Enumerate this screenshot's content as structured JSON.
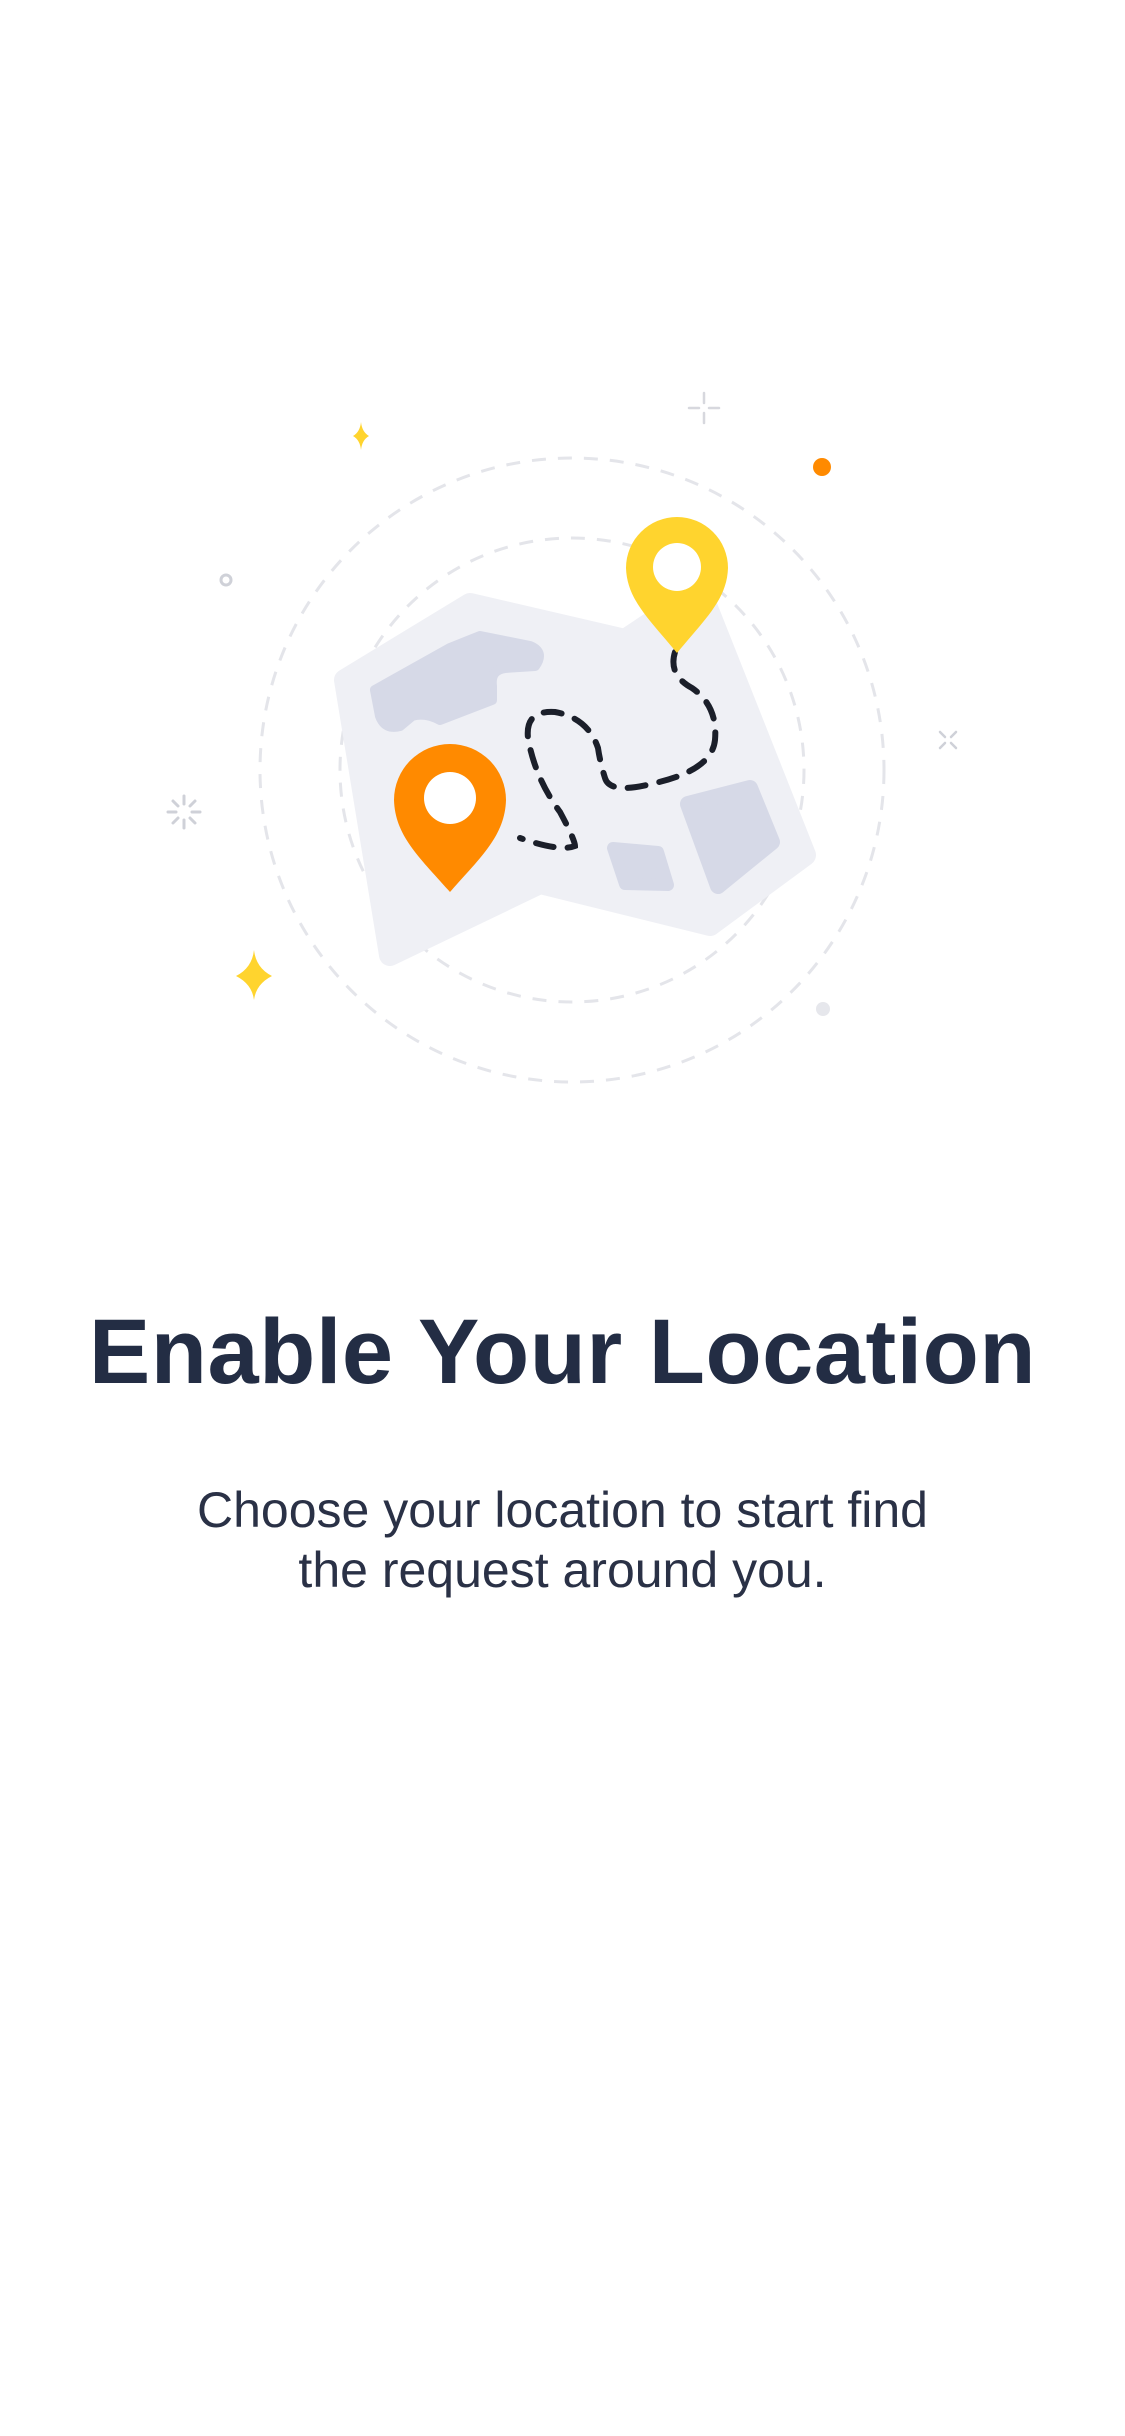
{
  "onboarding": {
    "title": "Enable Your Location",
    "subtitle": "Choose your location to start find the request around you."
  },
  "illustration": {
    "icons": [
      "map-icon",
      "location-pin-icon",
      "sparkle-icon",
      "dashed-route"
    ],
    "colors": {
      "pin_primary": "#FFD42E",
      "pin_secondary": "#FF8A00",
      "map": "#EFF0F5",
      "map_blocks": "#D6D9E7",
      "route": "#1B1F2A",
      "title": "#232D44"
    }
  }
}
